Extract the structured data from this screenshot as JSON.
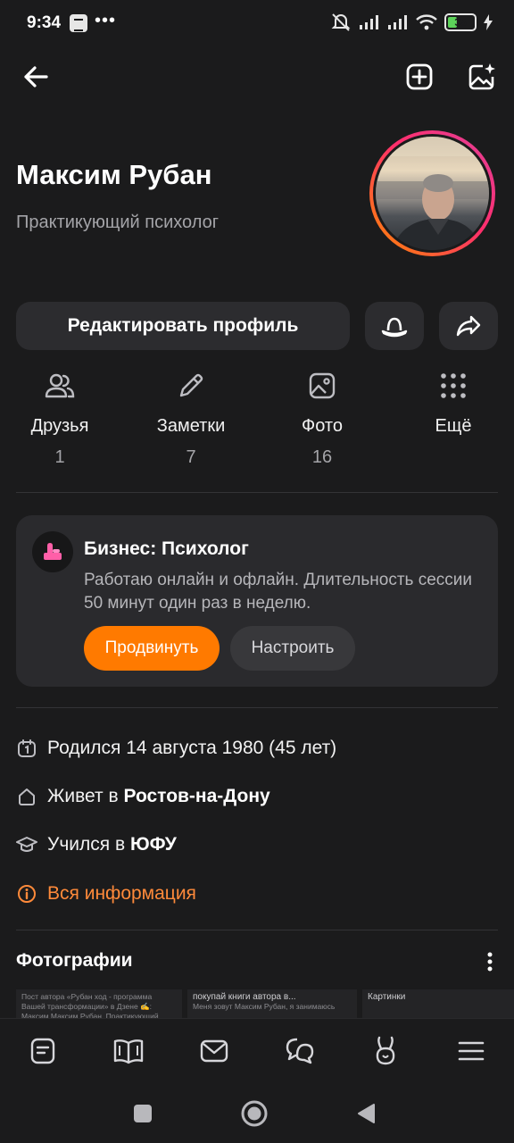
{
  "status_bar": {
    "time": "9:34",
    "dots": "•••",
    "battery": "35"
  },
  "topbar": {
    "back_icon": "arrow-left-icon",
    "add_icon": "plus-square-icon",
    "magic_photo_icon": "image-sparkle-icon"
  },
  "profile": {
    "name": "Максим Рубан",
    "status": "Практикующий психолог",
    "edit_button": "Редактировать профиль",
    "hat_icon": "hat-icon",
    "share_icon": "share-arrow-icon"
  },
  "stats": [
    {
      "label": "Друзья",
      "count": "1",
      "icon": "friends-icon"
    },
    {
      "label": "Заметки",
      "count": "7",
      "icon": "pencil-icon"
    },
    {
      "label": "Фото",
      "count": "16",
      "icon": "photo-icon"
    },
    {
      "label": "Ещё",
      "count": "",
      "icon": "grid-dots-icon"
    }
  ],
  "business": {
    "title": "Бизнес: Психолог",
    "description": "Работаю онлайн и офлайн. Длительность сессии 50 минут один раз в неделю.",
    "promote_button": "Продвинуть",
    "setup_button": "Настроить",
    "accent_color": "#ff7a00"
  },
  "info": {
    "birth": "Родился 14 августа 1980 (45 лет)",
    "lives_prefix": "Живет в ",
    "lives_city": "Ростов-на-Дону",
    "studied_prefix": "Учился в ",
    "studied_place": "ЮФУ",
    "all_info": "Вся информация",
    "link_color": "#ff8a3a"
  },
  "photos": {
    "title": "Фотографии",
    "items": [
      {
        "text": "Пост автора «Рубан ход - программа Вашей трансформации» в Дзене ✍️: Максим Максим Рубан. Практикующий психолог"
      },
      {
        "title": "покупай книги автора в...",
        "text": "Меня зовут Максим Рубан, я занимаюсь"
      },
      {
        "title": "Картинки",
        "text": ""
      }
    ]
  },
  "bottom_nav": [
    "feed-icon",
    "book-icon",
    "mail-icon",
    "chat-bubbles-icon",
    "bunny-icon",
    "menu-icon"
  ],
  "system_nav": [
    "recent-apps-icon",
    "home-icon",
    "back-icon"
  ]
}
